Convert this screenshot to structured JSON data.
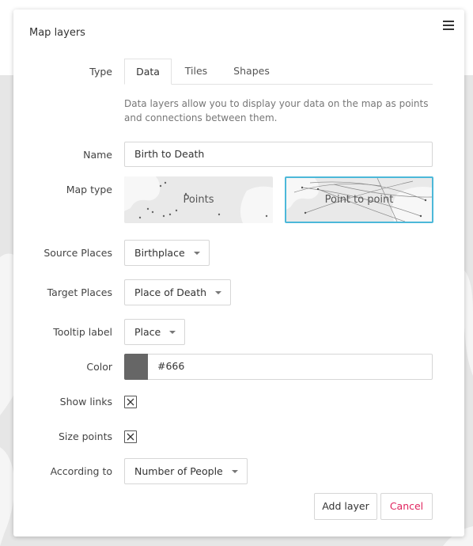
{
  "panel": {
    "title": "Map layers",
    "menu_icon": "hamburger-menu-icon"
  },
  "type_field": {
    "label": "Type",
    "tabs": [
      {
        "label": "Data",
        "active": true
      },
      {
        "label": "Tiles",
        "active": false
      },
      {
        "label": "Shapes",
        "active": false
      }
    ],
    "help": "Data layers allow you to display your data on the map as points and connections between them."
  },
  "name_field": {
    "label": "Name",
    "value": "Birth to Death"
  },
  "map_type": {
    "label": "Map type",
    "options": [
      {
        "label": "Points",
        "selected": false
      },
      {
        "label": "Point to point",
        "selected": true
      }
    ]
  },
  "source_places": {
    "label": "Source Places",
    "value": "Birthplace"
  },
  "target_places": {
    "label": "Target Places",
    "value": "Place of Death"
  },
  "tooltip_label": {
    "label": "Tooltip label",
    "value": "Place"
  },
  "color": {
    "label": "Color",
    "value": "#666",
    "swatch": "#666666"
  },
  "show_links": {
    "label": "Show links",
    "checked": true
  },
  "size_points": {
    "label": "Size points",
    "checked": true
  },
  "according_to": {
    "label": "According to",
    "value": "Number of People"
  },
  "actions": {
    "add_label": "Add layer",
    "cancel_label": "Cancel"
  },
  "colors": {
    "accent": "#4cb8d9",
    "cancel": "#e0245e"
  }
}
